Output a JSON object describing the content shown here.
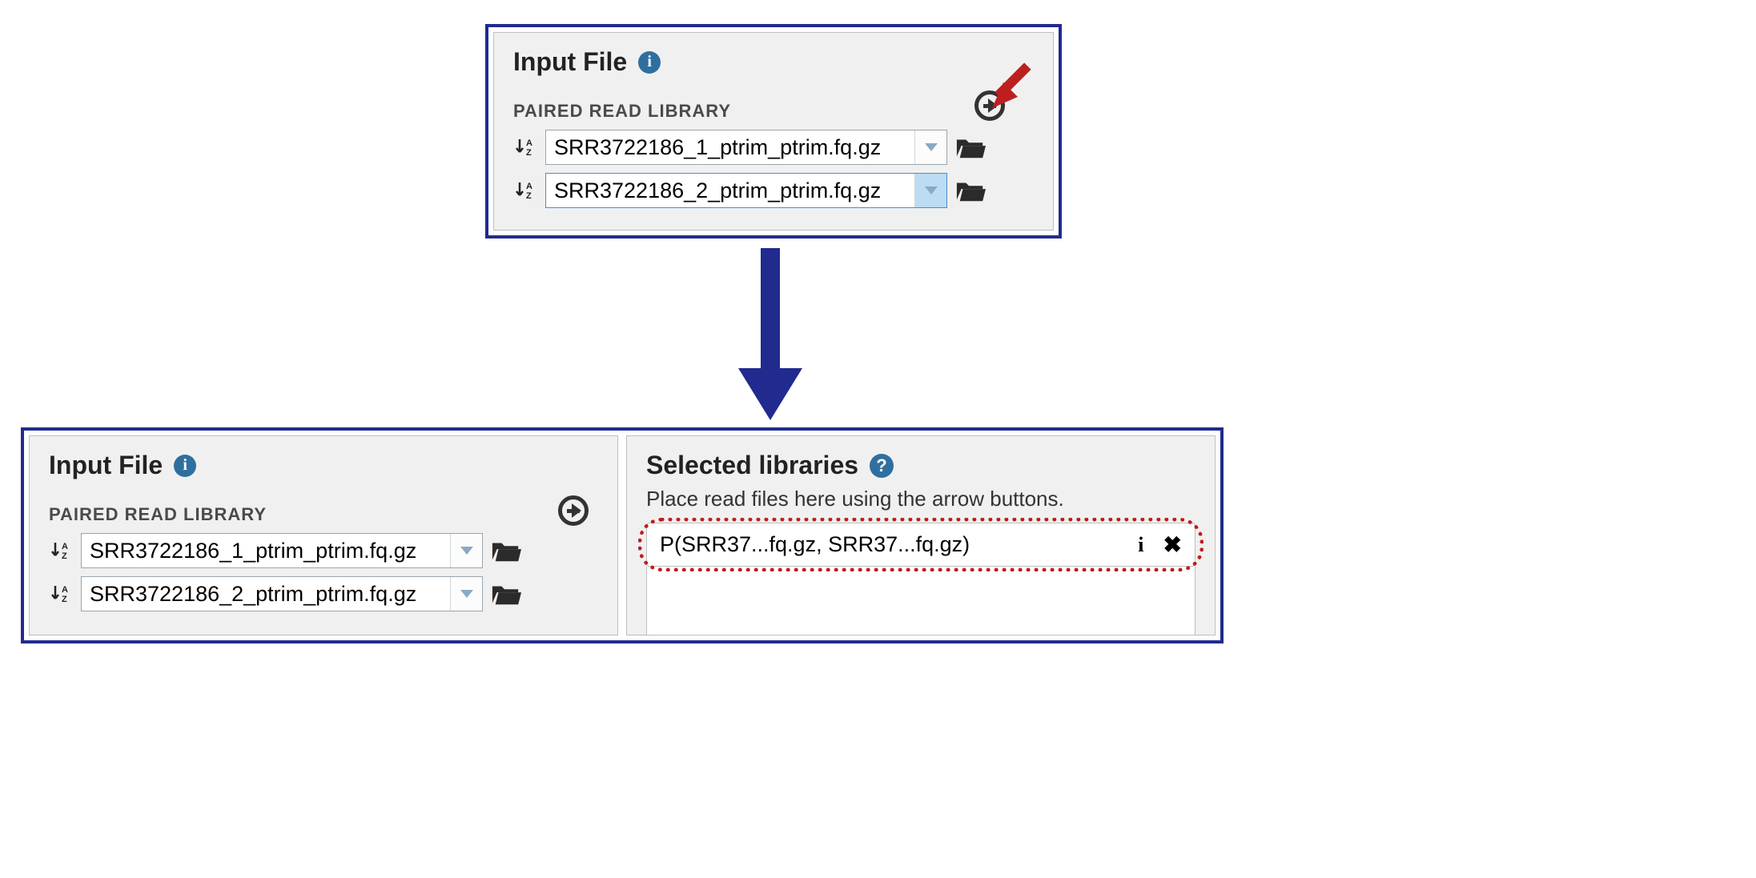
{
  "top_panel": {
    "title": "Input File",
    "subheader": "PAIRED READ LIBRARY",
    "files": [
      "SRR3722186_1_ptrim_ptrim.fq.gz",
      "SRR3722186_2_ptrim_ptrim.fq.gz"
    ]
  },
  "bottom_left": {
    "title": "Input File",
    "subheader": "PAIRED READ LIBRARY",
    "files": [
      "SRR3722186_1_ptrim_ptrim.fq.gz",
      "SRR3722186_2_ptrim_ptrim.fq.gz"
    ]
  },
  "bottom_right": {
    "title": "Selected libraries",
    "hint": "Place read files here using the arrow buttons.",
    "entry": "P(SRR37...fq.gz, SRR37...fq.gz)"
  }
}
